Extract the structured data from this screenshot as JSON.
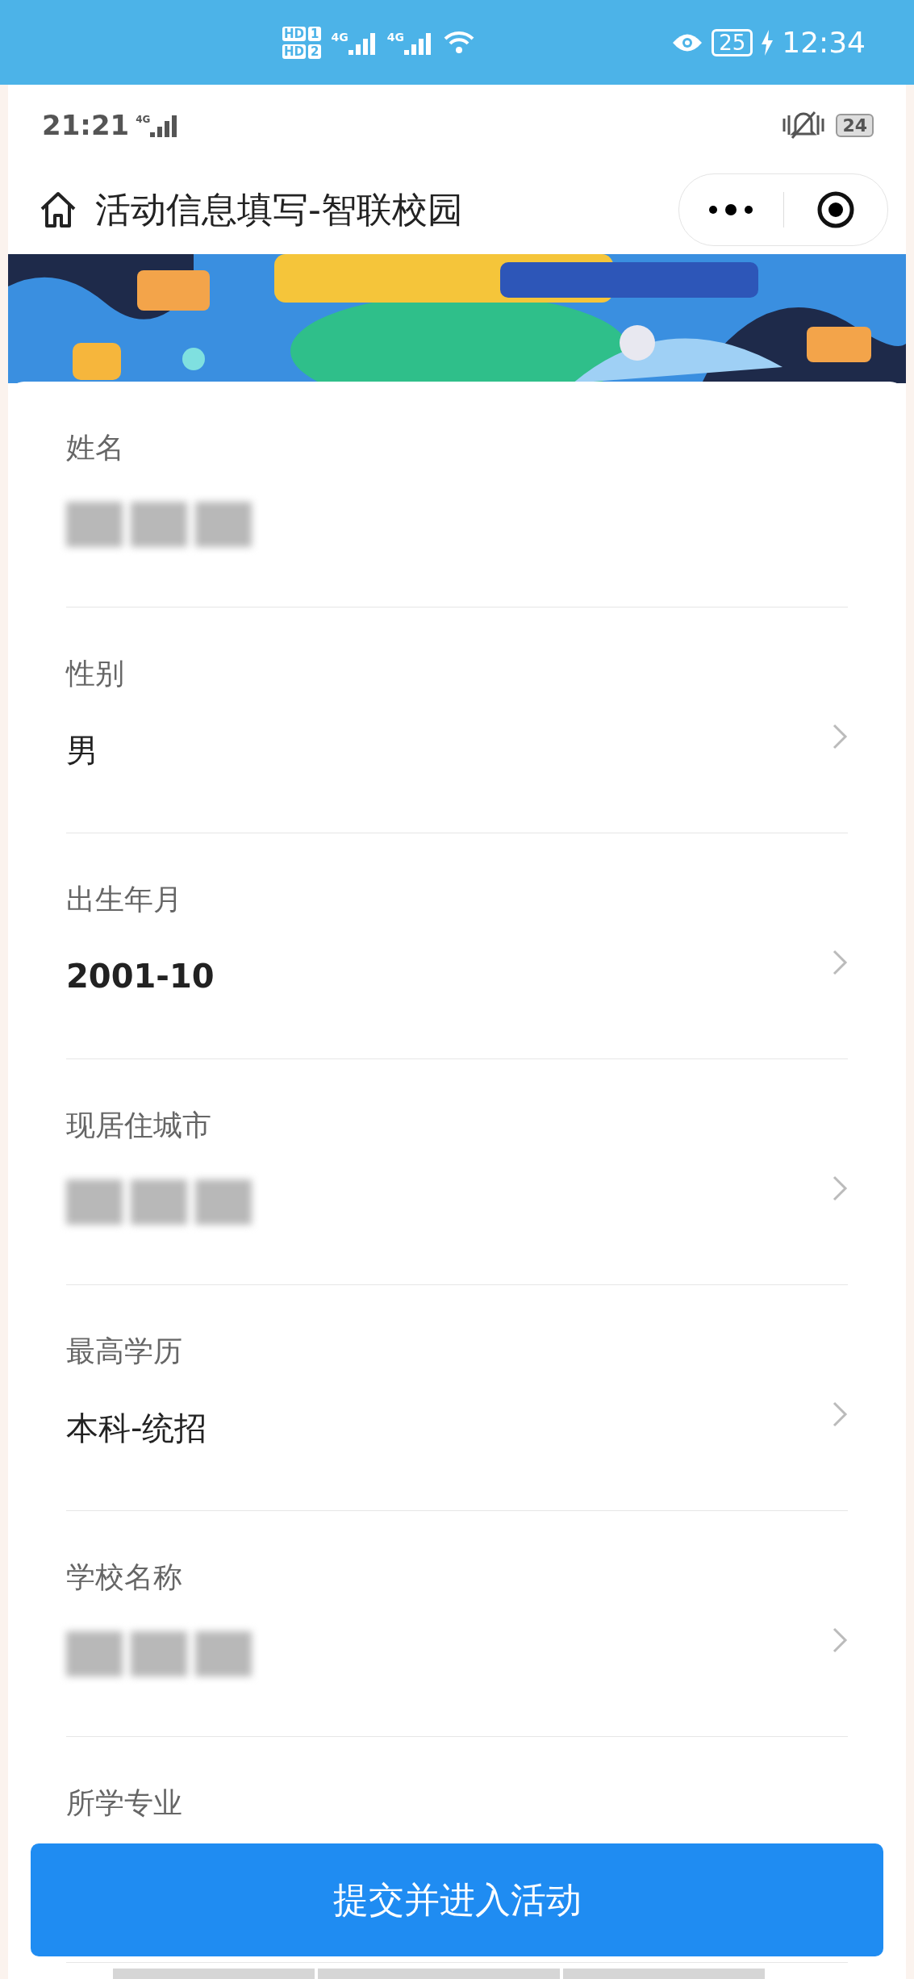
{
  "phone_status_bar": {
    "sims": [
      {
        "badge": "HD",
        "slot": "1"
      },
      {
        "badge": "HD",
        "slot": "2"
      }
    ],
    "networks": [
      "4G",
      "4G"
    ],
    "battery": "25",
    "charging": true,
    "time": "12:34"
  },
  "inner_status_bar": {
    "time": "21:21",
    "network": "4G",
    "battery": "24"
  },
  "nav_bar": {
    "title": "活动信息填写-智联校园"
  },
  "form": {
    "fields": [
      {
        "label": "姓名",
        "kind": "blurred",
        "arrow": false
      },
      {
        "label": "性别",
        "kind": "text",
        "value": "男",
        "arrow": true
      },
      {
        "label": "出生年月",
        "kind": "strong",
        "value": "2001-10",
        "arrow": true
      },
      {
        "label": "现居住城市",
        "kind": "blurred",
        "arrow": true
      },
      {
        "label": "最高学历",
        "kind": "text",
        "value": "本科-统招",
        "arrow": true
      },
      {
        "label": "学校名称",
        "kind": "blurred",
        "arrow": true
      },
      {
        "label": "所学专业",
        "kind": "cut",
        "arrow": false
      }
    ]
  },
  "submit_button": "提交并进入活动"
}
